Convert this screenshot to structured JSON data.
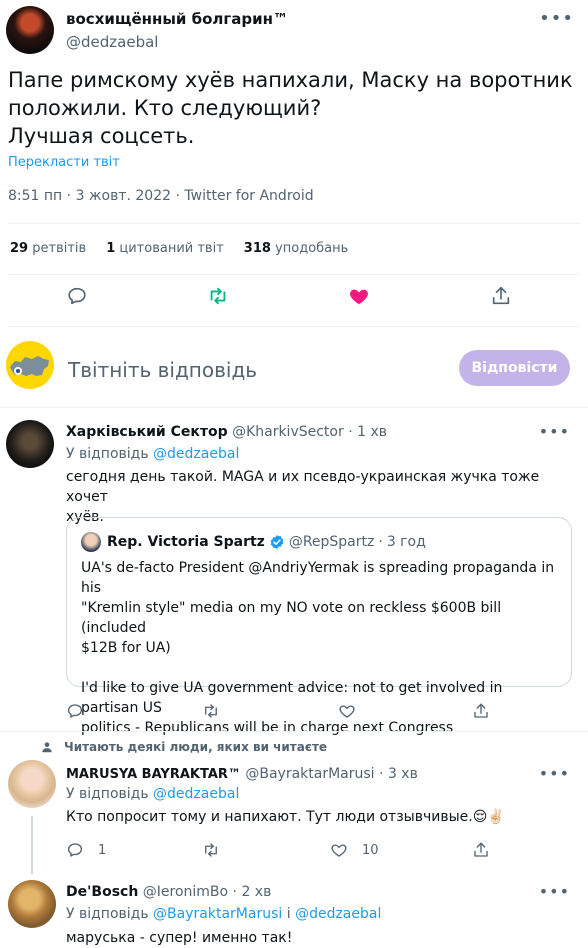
{
  "main": {
    "author_name": "восхищённый болгарин™",
    "author_handle": "@dedzaebal",
    "text_line1": "Папе римскому хуёв напихали, Маску на воротник",
    "text_line2": "положили. Кто следующий?",
    "text_line3": "Лучшая соцсеть.",
    "translate": "Перекласти твіт",
    "time": "8:51 пп",
    "date": "3 жовт. 2022",
    "source": "Twitter for Android",
    "retweets_count": "29",
    "retweets_label": "ретвітів",
    "quotes_count": "1",
    "quotes_label": "цитований твіт",
    "likes_count": "318",
    "likes_label": "уподобань",
    "like_color": "#f91880",
    "retweet_color": "#00ba7c"
  },
  "reply_box": {
    "placeholder": "Твітніть відповідь",
    "button": "Відповісти"
  },
  "reply1": {
    "name": "Харківський Сектор",
    "handle": "@KharkivSector",
    "time": "1 хв",
    "reply_to_label": "У відповідь",
    "reply_to_handle": "@dedzaebal",
    "text_line1": "сегодня день такой. MAGA и их псевдо-украинская жучка тоже хочет",
    "text_line2": "хуёв.",
    "quote": {
      "name": "Rep. Victoria Spartz",
      "handle": "@RepSpartz",
      "time": "3 год",
      "p1_line1": "UA's de-facto President @AndriyYermak is spreading propaganda in his",
      "p1_line2": "\"Kremlin style\" media on my NO vote on reckless $600B bill (included",
      "p1_line3": "$12B for UA)",
      "p2_line1": "I'd like to give UA government advice: not to get involved in partisan US",
      "p2_line2": "politics - Republicans will be in charge next Congress"
    }
  },
  "context_label": "Читають деякі люди, яких ви читаєте",
  "reply2": {
    "name": "MARUSYA BAYRAKTAR™",
    "handle": "@BayraktarMarusi",
    "time": "3 хв",
    "reply_to_label": "У відповідь",
    "reply_to_handle": "@dedzaebal",
    "text": "Кто попросит тому и напихают. Тут люди отзывчивые.",
    "emoji": "😌✌🏻",
    "replies": "1",
    "likes": "10"
  },
  "reply3": {
    "name": "De'Bosch",
    "handle": "@IeronimBo",
    "time": "2 хв",
    "reply_to_label": "У відповідь",
    "reply_to_handle1": "@BayraktarMarusi",
    "reply_to_and": "і",
    "reply_to_handle2": "@dedzaebal",
    "text": "маруська - супер! именно так!"
  },
  "sep": "·",
  "more": "•••"
}
